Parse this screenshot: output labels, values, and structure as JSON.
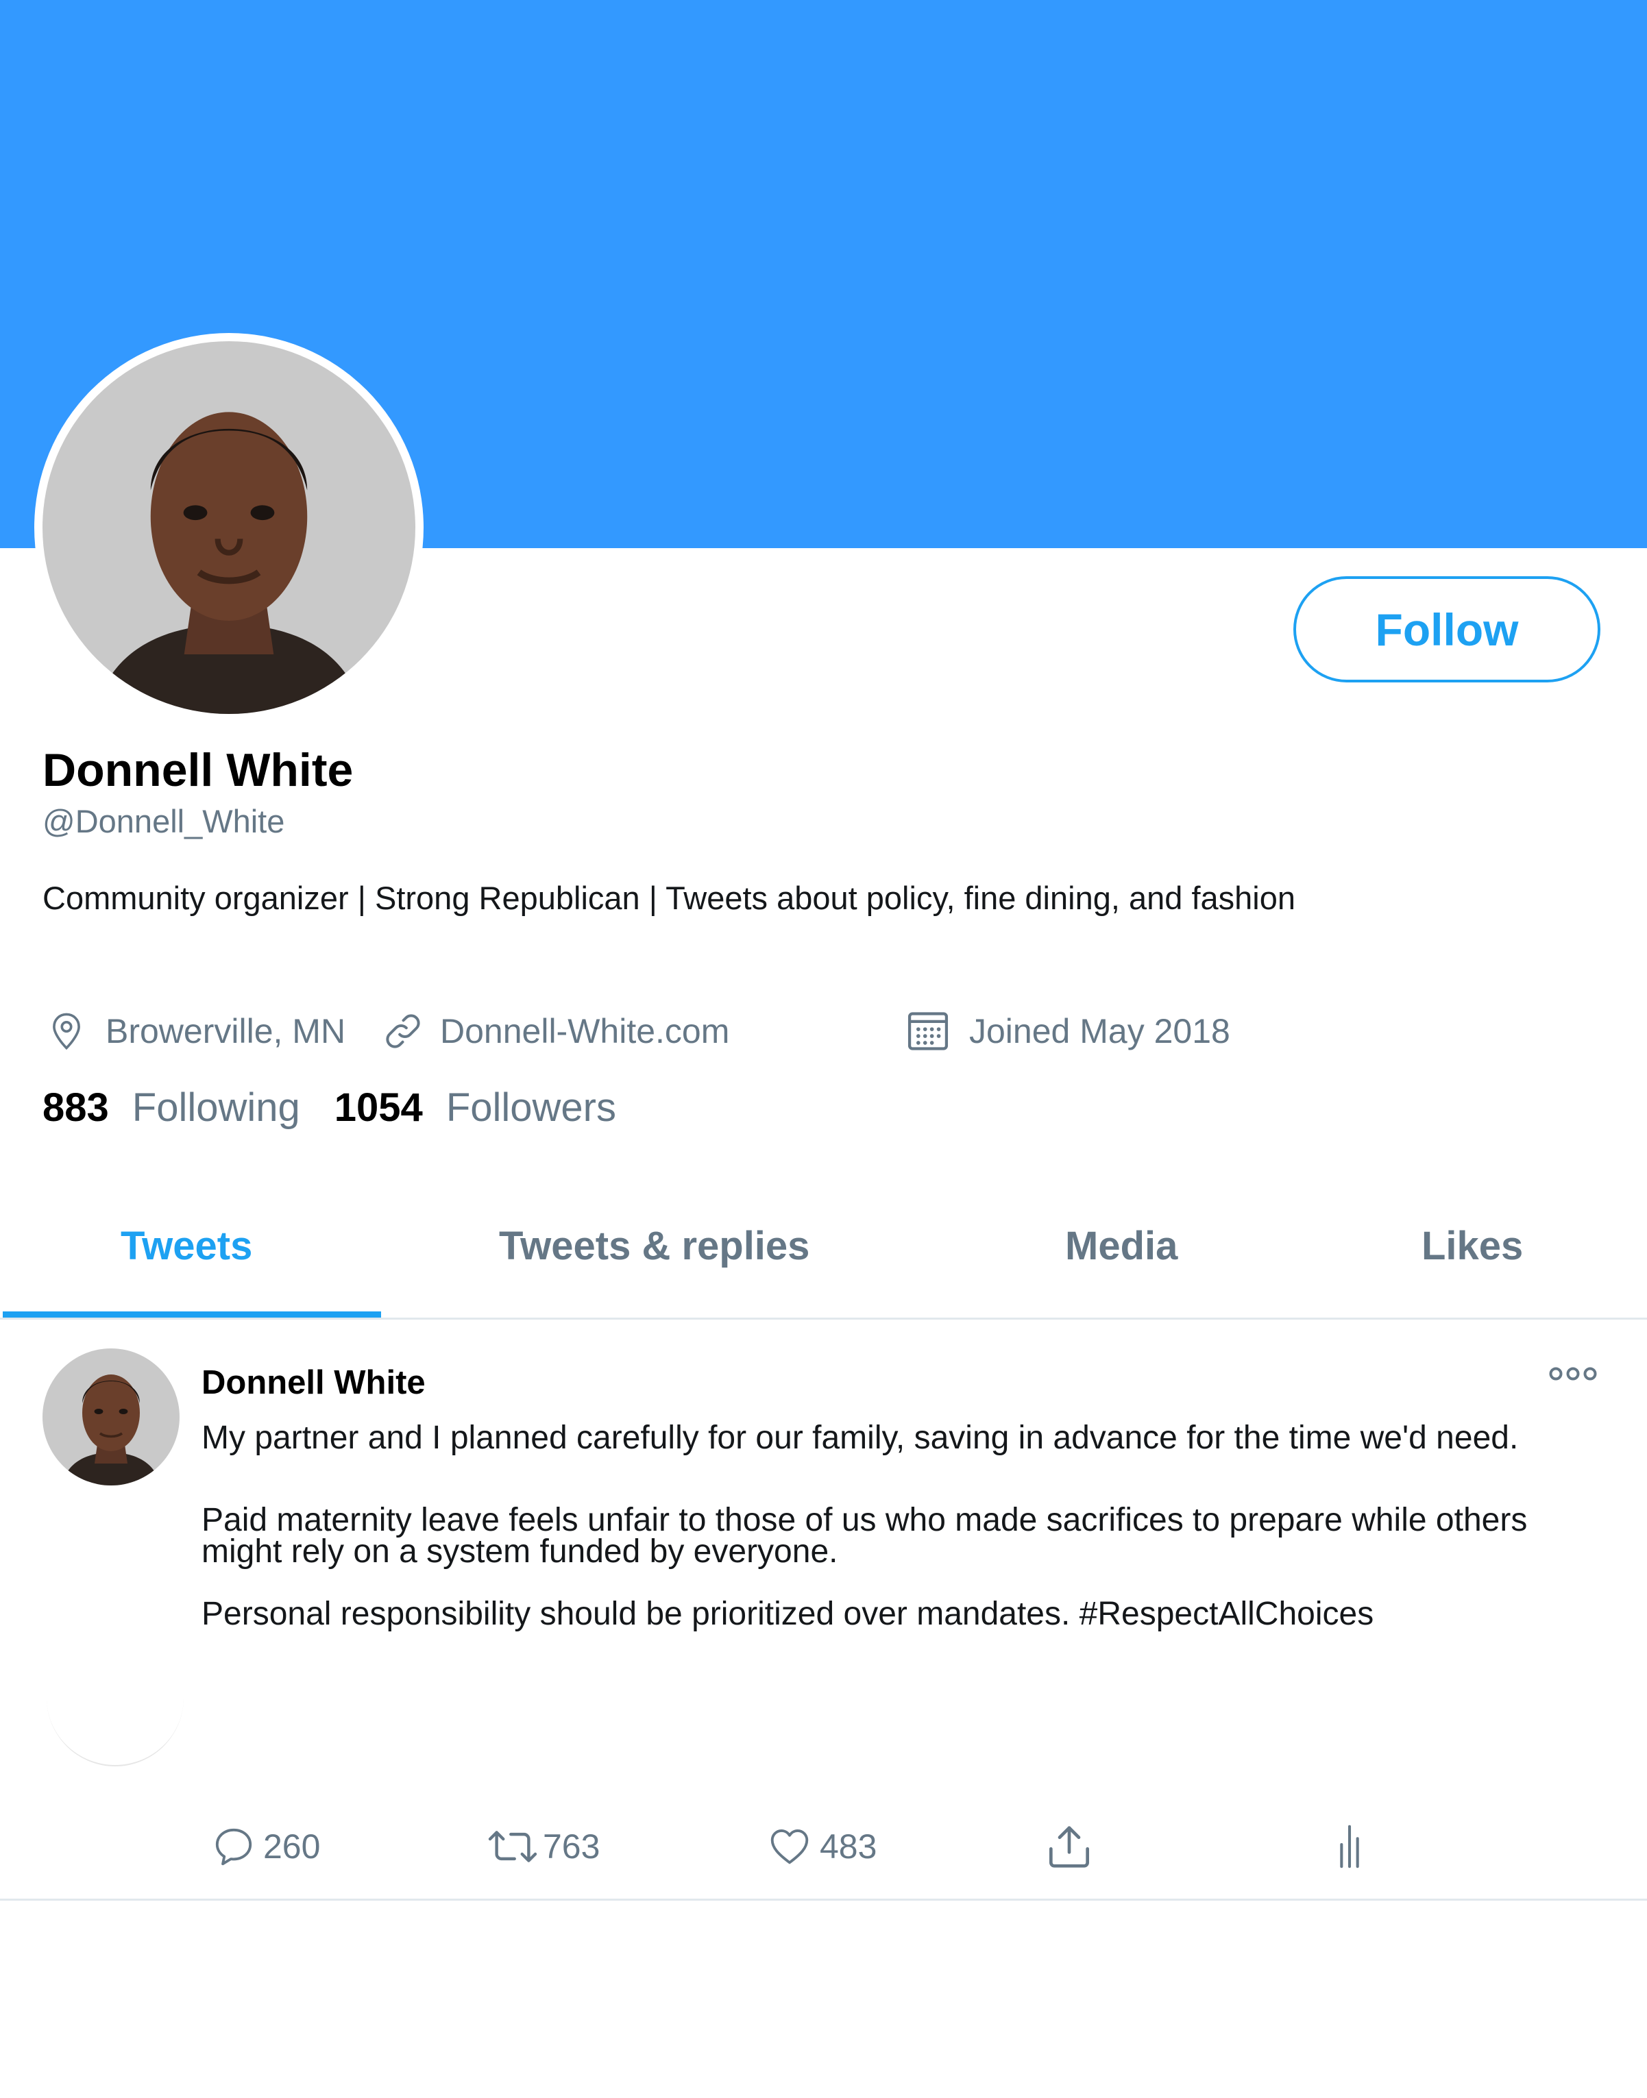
{
  "colors": {
    "banner": "#3399ff",
    "accent": "#1da1f2",
    "secondary_text": "#657786",
    "divider": "#e1e8ed"
  },
  "profile": {
    "display_name": "Donnell White",
    "handle": "@Donnell_White",
    "bio": "Community organizer | Strong Republican | Tweets about policy, fine dining, and fashion",
    "location": "Browerville, MN",
    "website": "Donnell-White.com",
    "joined": "Joined May 2018",
    "follow_label": "Follow",
    "following_count": "883",
    "following_label": "Following",
    "followers_count": "1054",
    "followers_label": "Followers"
  },
  "tabs": [
    {
      "label": "Tweets",
      "active": true
    },
    {
      "label": "Tweets & replies",
      "active": false
    },
    {
      "label": "Media",
      "active": false
    },
    {
      "label": "Likes",
      "active": false
    }
  ],
  "tweet": {
    "author": "Donnell White",
    "paragraphs": [
      "My partner and I planned carefully for our family, saving in advance for the time we'd need.",
      "Paid maternity leave feels unfair to those of us who made sacrifices to prepare while others might rely on a system funded by everyone.",
      "Personal responsibility should be prioritized over mandates. #RespectAllChoices"
    ],
    "reply_count": "260",
    "retweet_count": "763",
    "like_count": "483"
  },
  "icons": {
    "location": "location-pin-icon",
    "website": "link-icon",
    "joined": "calendar-icon",
    "reply": "reply-icon",
    "retweet": "retweet-icon",
    "like": "heart-icon",
    "share": "share-icon",
    "analytics": "analytics-icon",
    "more": "more-icon"
  }
}
